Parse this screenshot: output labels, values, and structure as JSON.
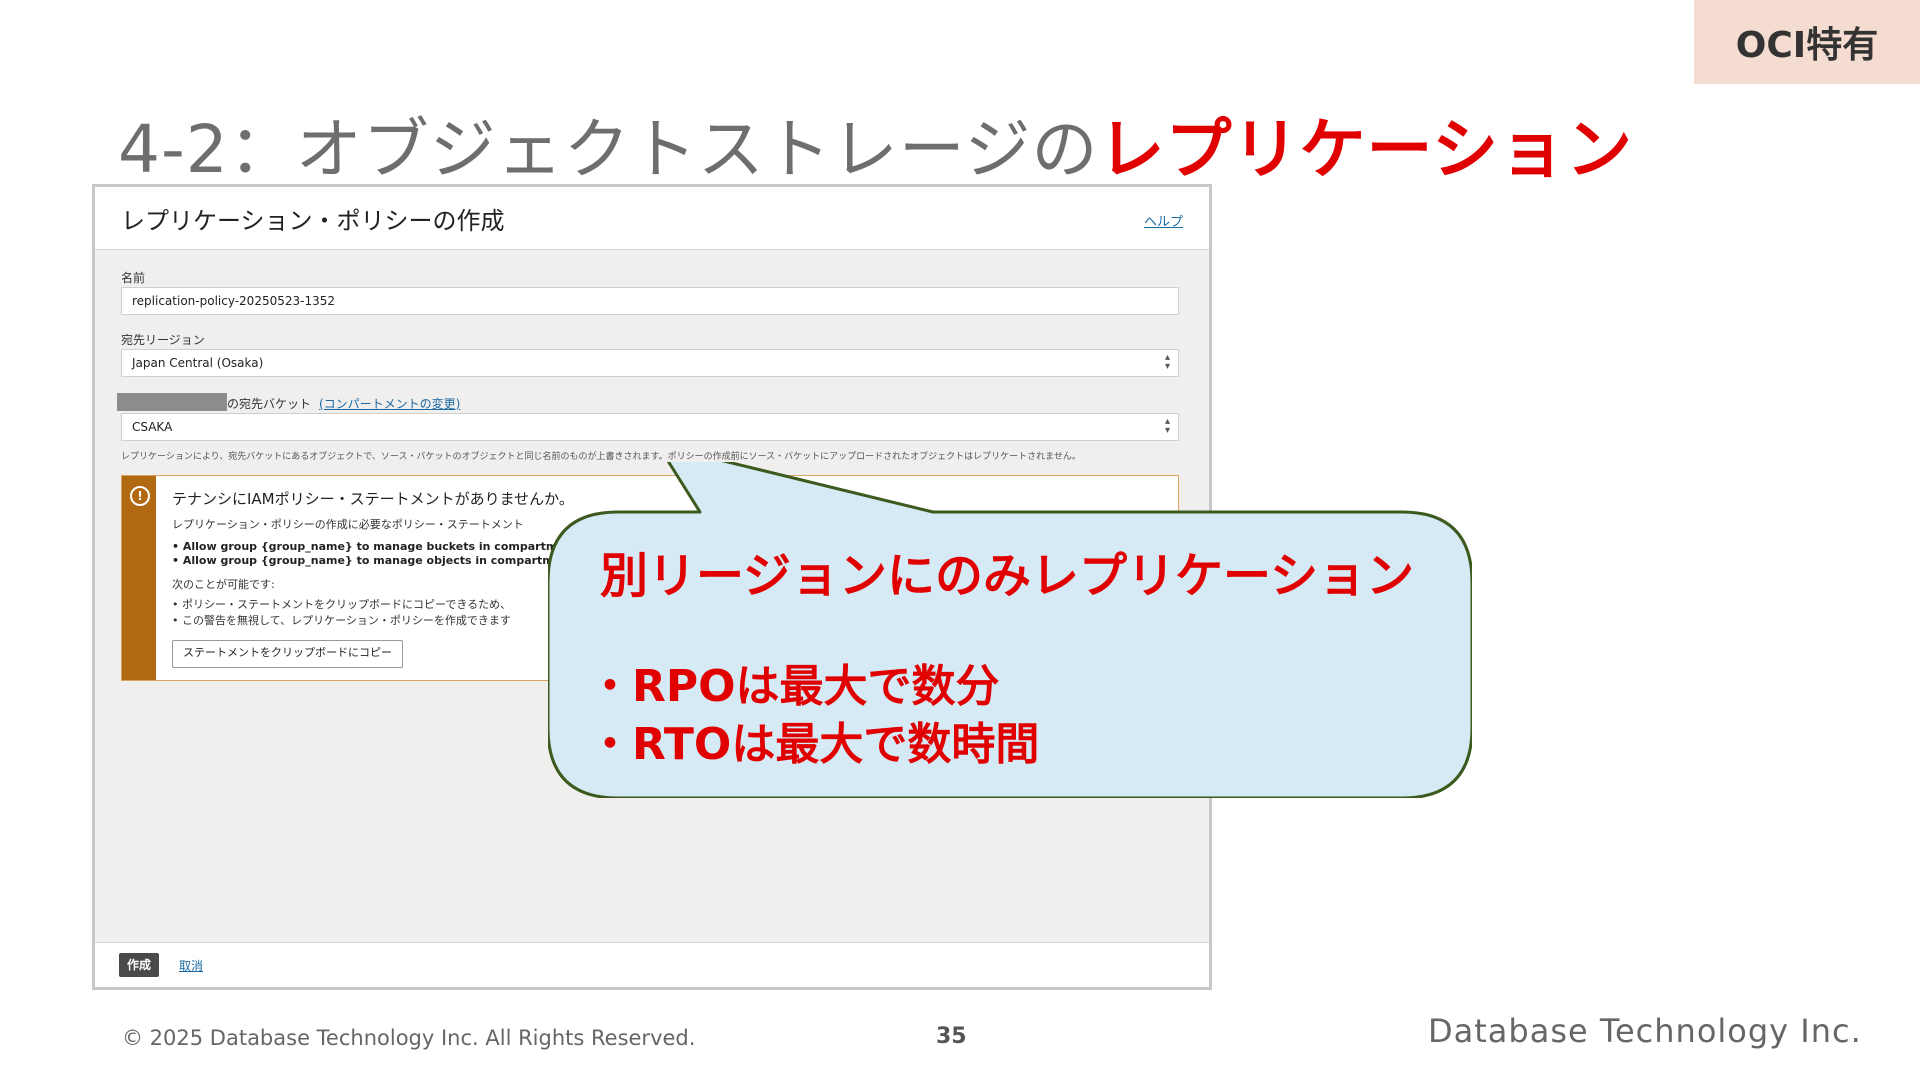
{
  "badge": "OCI特有",
  "slide_title": {
    "prefix": "4-2：オブジェクトストレージの",
    "accent": "レプリケーション"
  },
  "dialog": {
    "title": "レプリケーション・ポリシーの作成",
    "help_link": "ヘルプ",
    "name_label": "名前",
    "name_value": "replication-policy-20250523-1352",
    "region_label": "宛先リージョン",
    "region_value": "Japan Central (Osaka)",
    "bucket_label": "の宛先バケット",
    "compartment_link": "(コンパートメントの変更)",
    "bucket_value": "CSAKA",
    "help_text": "レプリケーションにより、宛先バケットにあるオブジェクトで、ソース・バケットのオブジェクトと同じ名前のものが上書きされます。ポリシーの作成前にソース・バケットにアップロードされたオブジェクトはレプリケートされません。",
    "warning": {
      "title": "テナンシにIAMポリシー・ステートメントがありませんか。",
      "subtitle": "レプリケーション・ポリシーの作成に必要なポリシー・ステートメント",
      "code_lines": [
        "•  Allow group {group_name} to manage buckets in compartment",
        "•  Allow group {group_name} to manage objects in compartment"
      ],
      "can_do": "次のことが可能です:",
      "items": [
        "•  ポリシー・ステートメントをクリップボードにコピーできるため、",
        "•  この警告を無視して、レプリケーション・ポリシーを作成できます"
      ],
      "copy_button": "ステートメントをクリップボードにコピー"
    },
    "create_button": "作成",
    "cancel_link": "取消"
  },
  "callout": {
    "heading": "別リージョンにのみレプリケーション",
    "items": [
      "・RPOは最大で数分",
      "・RTOは最大で数時間"
    ],
    "fill_color": "#d6eaf6",
    "border_color": "#3c5a1e"
  },
  "footer": {
    "copyright": "© 2025 Database Technology Inc. All Rights Reserved.",
    "page_number": "35",
    "logo": "Database Technology Inc."
  }
}
